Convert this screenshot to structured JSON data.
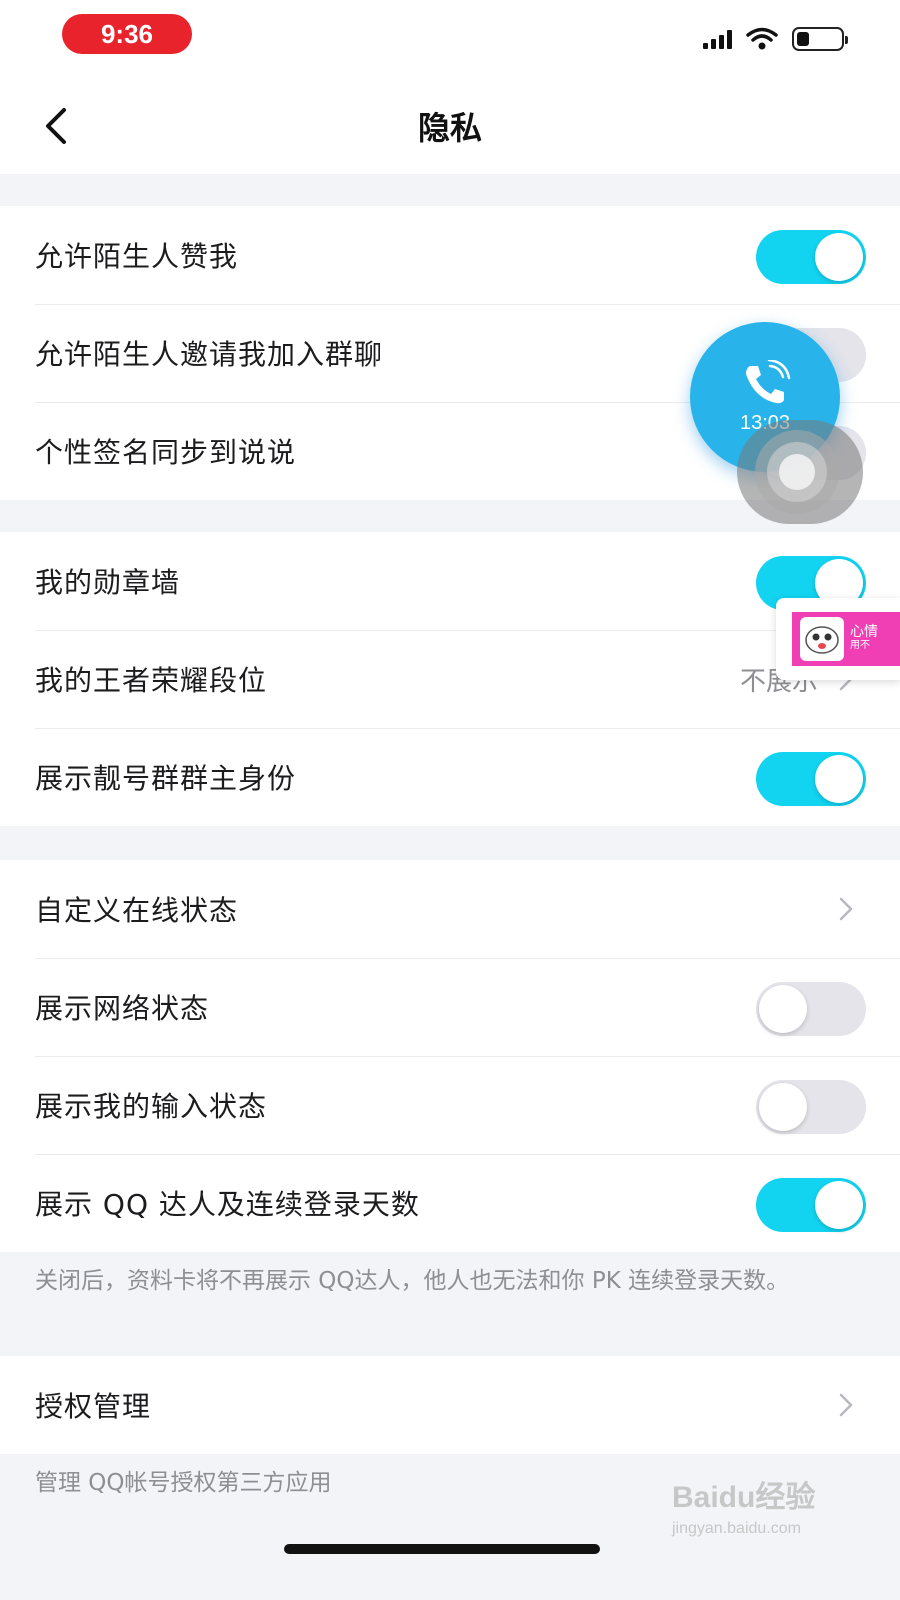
{
  "status_bar": {
    "time": "9:36",
    "icons": [
      "signal-icon",
      "wifi-icon",
      "battery-icon"
    ],
    "battery_level": 0.2
  },
  "nav": {
    "title": "隐私",
    "back_icon": "chevron-left-icon"
  },
  "groups": [
    {
      "rows": [
        {
          "label": "允许陌生人赞我",
          "toggle": true
        },
        {
          "label": "允许陌生人邀请我加入群聊",
          "toggle": false
        },
        {
          "label": "个性签名同步到说说",
          "toggle": false
        }
      ]
    },
    {
      "rows": [
        {
          "label": "我的勋章墙",
          "toggle": true
        },
        {
          "label": "我的王者荣耀段位",
          "value": "不展示"
        },
        {
          "label": "展示靓号群群主身份",
          "toggle": true
        }
      ]
    },
    {
      "rows": [
        {
          "label": "自定义在线状态",
          "chevron": true
        },
        {
          "label": "展示网络状态",
          "toggle": false
        },
        {
          "label": "展示我的输入状态",
          "toggle": false
        },
        {
          "label": "展示 QQ 达人及连续登录天数",
          "toggle": true
        }
      ],
      "footnote": "关闭后，资料卡将不再展示 QQ达人，他人也无法和你 PK 连续登录天数。"
    },
    {
      "rows": [
        {
          "label": "授权管理",
          "chevron": true
        }
      ],
      "footnote": "管理 QQ帐号授权第三方应用"
    }
  ],
  "overlays": {
    "call_bubble": {
      "time": "13:03",
      "icon": "phone-icon"
    },
    "mood_banner": {
      "title": "心情",
      "subtitle": "用不"
    },
    "watermark": {
      "main": "Baidu经验",
      "sub": "jingyan.baidu.com"
    }
  },
  "colors": {
    "toggle_on": "#12d4f0",
    "toggle_off": "#e4e4ea",
    "time_pill": "#e8232c",
    "call_bubble": "#28b4ea",
    "background": "#f3f4f8"
  }
}
